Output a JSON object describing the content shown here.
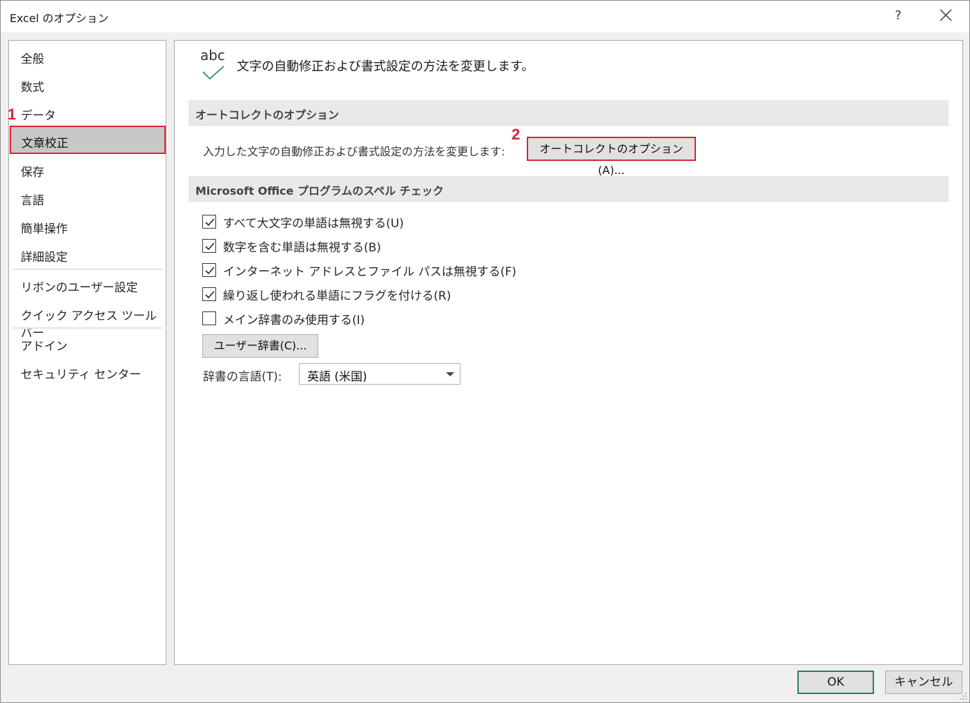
{
  "window": {
    "title": "Excel のオプション",
    "help_label": "?"
  },
  "sidebar": {
    "items": [
      {
        "label": "全般"
      },
      {
        "label": "数式"
      },
      {
        "label": "データ"
      },
      {
        "label": "文章校正",
        "selected": true
      },
      {
        "label": "保存"
      },
      {
        "label": "言語"
      },
      {
        "label": "簡単操作"
      },
      {
        "label": "詳細設定"
      },
      {
        "label": "リボンのユーザー設定"
      },
      {
        "label": "クイック アクセス ツール バー"
      },
      {
        "label": "アドイン"
      },
      {
        "label": "セキュリティ センター"
      }
    ]
  },
  "annotations": {
    "marker1": "1",
    "marker2": "2",
    "highlight_color": "#d9232e"
  },
  "content": {
    "icon_text": "abc",
    "header_description": "文字の自動修正および書式設定の方法を変更します。",
    "autocorrect_section": {
      "title": "オートコレクトのオプション",
      "description": "入力した文字の自動修正および書式設定の方法を変更します:",
      "button_label": "オートコレクトのオプション(A)..."
    },
    "spelling_section": {
      "title": "Microsoft Office プログラムのスペル チェック",
      "options": [
        {
          "label": "すべて大文字の単語は無視する(U)",
          "checked": true
        },
        {
          "label": "数字を含む単語は無視する(B)",
          "checked": true
        },
        {
          "label": "インターネット アドレスとファイル パスは無視する(F)",
          "checked": true
        },
        {
          "label": "繰り返し使われる単語にフラグを付ける(R)",
          "checked": true
        },
        {
          "label": "メイン辞書のみ使用する(I)",
          "checked": false
        }
      ],
      "custom_dict_button": "ユーザー辞書(C)...",
      "dict_language_label": "辞書の言語(T):",
      "dict_language_value": "英語 (米国)"
    }
  },
  "footer": {
    "ok_label": "OK",
    "cancel_label": "キャンセル",
    "ok_border_color": "#2e7d52"
  }
}
